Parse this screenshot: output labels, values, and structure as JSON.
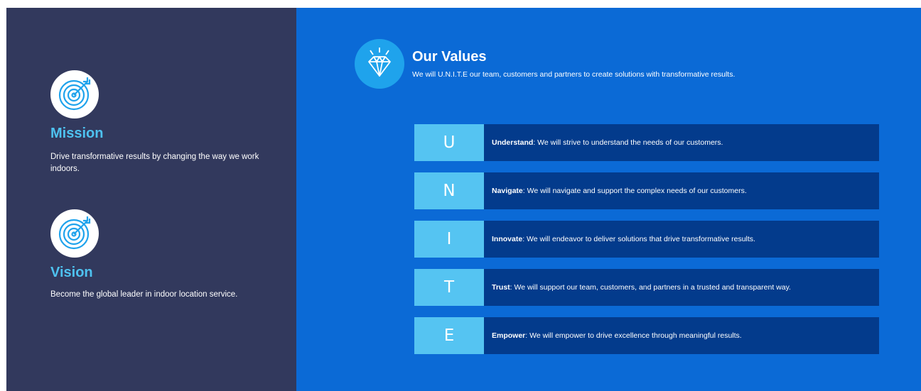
{
  "mission": {
    "icon": "target-icon",
    "title": "Mission",
    "text": "Drive transformative results by changing the way we work indoors."
  },
  "vision": {
    "icon": "target-icon",
    "title": "Vision",
    "text": "Become the global leader in indoor location service."
  },
  "values": {
    "icon": "diamond-icon",
    "title": "Our Values",
    "subtitle": "We will U.N.I.T.E our team, customers and partners to create solutions with transformative results.",
    "items": [
      {
        "letter": "U",
        "term": "Understand",
        "text": ": We will strive to understand the needs of our customers."
      },
      {
        "letter": "N",
        "term": "Navigate",
        "text": ": We will navigate and support the complex needs of our customers."
      },
      {
        "letter": "I",
        "term": "Innovate",
        "text": ": We will endeavor to deliver solutions that drive transformative results."
      },
      {
        "letter": "T",
        "term": "Trust",
        "text": ": We will support our team, customers, and partners in a trusted and transparent way."
      },
      {
        "letter": "E",
        "term": "Empower",
        "text": ": We will empower to drive excellence through meaningful results."
      }
    ]
  },
  "colors": {
    "left_panel": "#32395d",
    "right_panel": "#0b6ad6",
    "accent": "#4ec2f0",
    "letter_box": "#55c4f2",
    "desc_box": "#033b8c"
  }
}
